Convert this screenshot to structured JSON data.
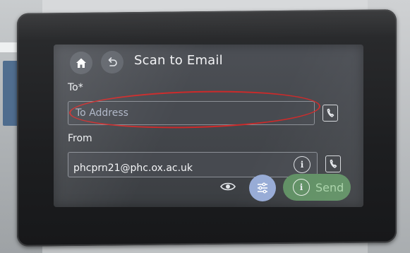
{
  "header": {
    "title": "Scan to Email",
    "home_icon": "home-icon",
    "back_icon": "back-icon"
  },
  "to": {
    "label": "To*",
    "placeholder": "To Address",
    "value": "",
    "contacts_icon": "contacts-icon"
  },
  "from": {
    "label": "From",
    "value": "phcprn21@phc.ox.ac.uk",
    "info_icon": "info-icon",
    "contacts_icon": "contacts-icon"
  },
  "actions": {
    "preview_icon": "eye-icon",
    "settings_icon": "sliders-icon",
    "send_label": "Send",
    "send_info_icon": "info-icon"
  },
  "annotation": {
    "highlight": "red-ellipse-around-to-field"
  },
  "colors": {
    "screen_bg": "#45484d",
    "accent_settings": "#97abd6",
    "send_button": "#5f8f63",
    "send_text": "#a9d3a9",
    "highlight": "#cc2a2a"
  }
}
